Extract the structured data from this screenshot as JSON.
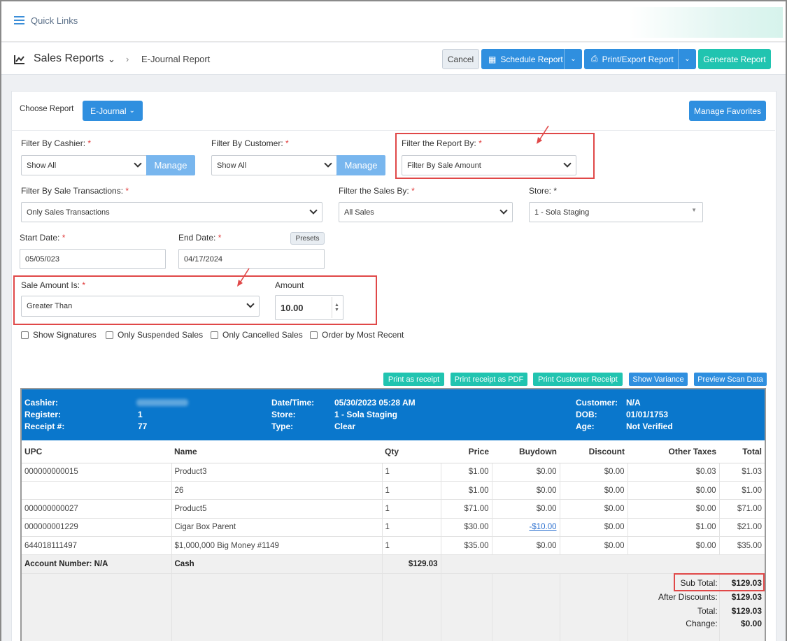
{
  "topbar": {
    "quick_links": "Quick Links"
  },
  "header": {
    "title": "Sales Reports",
    "breadcrumb": "E-Journal Report",
    "cancel": "Cancel",
    "schedule": "Schedule Report",
    "print_export": "Print/Export Report",
    "generate": "Generate Report"
  },
  "report": {
    "choose_label": "Choose Report",
    "choose_value": "E-Journal",
    "manage_favorites": "Manage Favorites"
  },
  "filters": {
    "cashier_label": "Filter By Cashier:",
    "cashier_value": "Show All",
    "customer_label": "Filter By Customer:",
    "customer_value": "Show All",
    "manage": "Manage",
    "report_by_label": "Filter the Report By:",
    "report_by_value": "Filter By Sale Amount",
    "sale_tx_label": "Filter By Sale Transactions:",
    "sale_tx_value": "Only Sales Transactions",
    "sales_by_label": "Filter the Sales By:",
    "sales_by_value": "All Sales",
    "store_label": "Store: *",
    "store_value": "1 - Sola Staging",
    "start_label": "Start Date:",
    "start_value": "05/05/023",
    "end_label": "End Date:",
    "end_value": "04/17/2024",
    "presets": "Presets",
    "sale_amount_label": "Sale Amount Is:",
    "sale_amount_value": "Greater Than",
    "amount_label": "Amount",
    "amount_value": "10.00",
    "required_mark": "*"
  },
  "checkboxes": {
    "signatures": "Show Signatures",
    "suspended": "Only Suspended Sales",
    "cancelled": "Only Cancelled Sales",
    "recent": "Order by Most Recent"
  },
  "toolbar": {
    "print_receipt": "Print as receipt",
    "print_pdf": "Print receipt as PDF",
    "print_customer": "Print Customer Receipt",
    "show_variance": "Show Variance",
    "preview_scan": "Preview Scan Data"
  },
  "receipt_header": {
    "cashier_k": "Cashier:",
    "register_k": "Register:",
    "register_v": "1",
    "receipt_k": "Receipt #:",
    "receipt_v": "77",
    "datetime_k": "Date/Time:",
    "datetime_v": "05/30/2023 05:28 AM",
    "store_k": "Store:",
    "store_v": "1 - Sola Staging",
    "type_k": "Type:",
    "type_v": "Clear",
    "customer_k": "Customer:",
    "customer_v": "N/A",
    "dob_k": "DOB:",
    "dob_v": "01/01/1753",
    "age_k": "Age:",
    "age_v": "Not Verified"
  },
  "table": {
    "columns": [
      "UPC",
      "Name",
      "Qty",
      "Price",
      "Buydown",
      "Discount",
      "Other Taxes",
      "Total"
    ],
    "rows": [
      [
        "000000000015",
        "Product3",
        "1",
        "$1.00",
        "$0.00",
        "$0.00",
        "$0.03",
        "$1.03"
      ],
      [
        "",
        "26",
        "1",
        "$1.00",
        "$0.00",
        "$0.00",
        "$0.00",
        "$1.00"
      ],
      [
        "000000000027",
        "Product5",
        "1",
        "$71.00",
        "$0.00",
        "$0.00",
        "$0.00",
        "$71.00"
      ],
      [
        "000000001229",
        "Cigar Box Parent",
        "1",
        "$30.00",
        "-$10.00",
        "$0.00",
        "$1.00",
        "$21.00"
      ],
      [
        "644018111497",
        "$1,000,000 Big Money #1149",
        "1",
        "$35.00",
        "$0.00",
        "$0.00",
        "$0.00",
        "$35.00"
      ]
    ],
    "account": "Account Number: N/A",
    "payment": "Cash",
    "payment_amount": "$129.03"
  },
  "totals": {
    "subtotal_k": "Sub Total:",
    "subtotal_v": "$129.03",
    "after_disc_k": "After Discounts:",
    "after_disc_v": "$129.03",
    "total_k": "Total:",
    "total_v": "$129.03",
    "change_k": "Change:",
    "change_v": "$0.00"
  }
}
